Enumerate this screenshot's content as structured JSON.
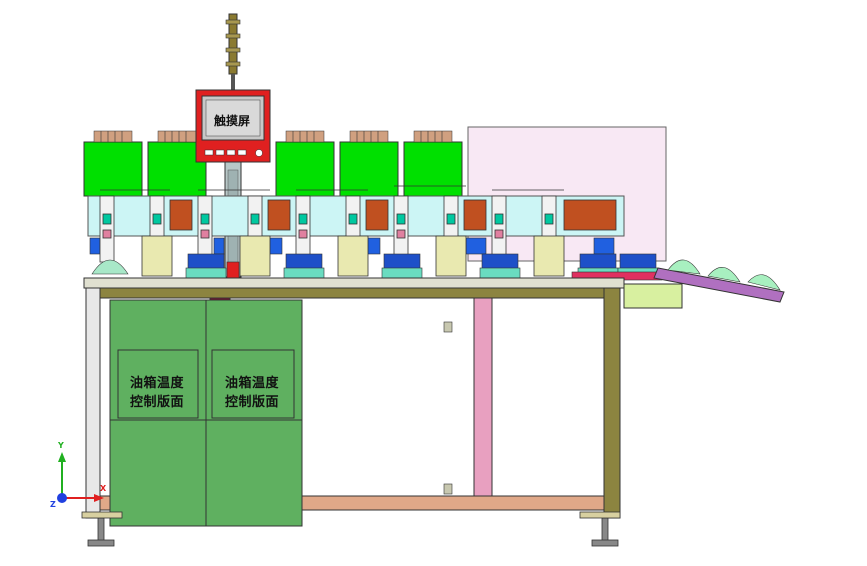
{
  "labels": {
    "touch_screen": "触摸屏",
    "oil_panel_left_line1": "油箱温度",
    "oil_panel_left_line2": "控制版面",
    "oil_panel_right_line1": "油箱温度",
    "oil_panel_right_line2": "控制版面"
  },
  "triad": {
    "y_label": "Y",
    "x_label": "X",
    "z_label": "Z"
  },
  "colors": {
    "cabinet_green": "#00e000",
    "panel_dark_green": "#5fb060",
    "frame_olive": "#8c8440",
    "touch_screen_red": "#e02020",
    "pink_enclosure": "#f8e8f4",
    "brown_plate": "#c05020",
    "light_cyan": "#ccf5f5",
    "conveyor_purple": "#b070c0"
  }
}
